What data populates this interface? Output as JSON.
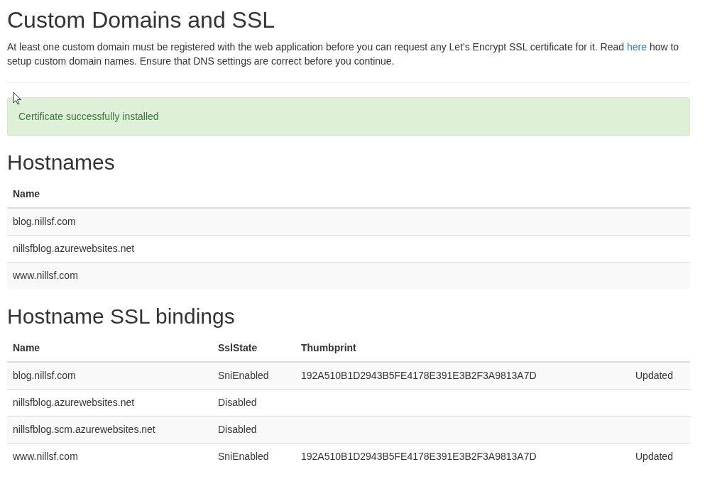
{
  "title": "Custom Domains and SSL",
  "intro": {
    "before": "At least one custom domain must be registered with the web application before you can request any Let's Encrypt SSL certificate for it. Read",
    "link": "here",
    "after": "how to setup custom domain names. Ensure that DNS settings are correct before you continue."
  },
  "alert": {
    "kind": "success",
    "text": "Certificate successfully installed"
  },
  "hostnames": {
    "heading": "Hostnames",
    "columns": [
      "Name"
    ],
    "rows": [
      [
        "blog.nillsf.com"
      ],
      [
        "nillsfblog.azurewebsites.net"
      ],
      [
        "www.nillsf.com"
      ]
    ]
  },
  "bindings": {
    "heading": "Hostname SSL bindings",
    "columns": [
      "Name",
      "SslState",
      "Thumbprint"
    ],
    "rows": [
      {
        "name": "blog.nillsf.com",
        "ssl_state": "SniEnabled",
        "thumbprint": "192A510B1D2943B5FE4178E391E3B2F3A9813A7D",
        "column_4": "Updated"
      },
      {
        "name": "nillsfblog.azurewebsites.net",
        "ssl_state": "Disabled"
      },
      {
        "name": "nillsfblog.scm.azurewebsites.net",
        "ssl_state": "Disabled"
      },
      {
        "name": "www.nillsf.com",
        "ssl_state": "SniEnabled",
        "thumbprint": "192A510B1D2943B5FE4178E391E3B2F3A9813A7D",
        "column_4": "Updated"
      }
    ]
  }
}
